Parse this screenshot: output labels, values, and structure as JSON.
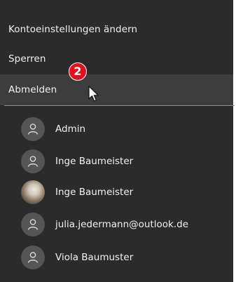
{
  "menu": {
    "items": [
      {
        "label": "Kontoeinstellungen ändern"
      },
      {
        "label": "Sperren"
      },
      {
        "label": "Abmelden"
      }
    ]
  },
  "users": [
    {
      "name": "Admin",
      "icon": "person-icon"
    },
    {
      "name": "Inge Baumeister",
      "icon": "person-icon"
    },
    {
      "name": "Inge Baumeister",
      "icon": "profile-photo"
    },
    {
      "name": "julia.jedermann@outlook.de",
      "icon": "person-icon"
    },
    {
      "name": "Viola Baumuster",
      "icon": "person-icon"
    }
  ],
  "annotation": {
    "badge": "2",
    "badge_color": "#e3101f"
  },
  "colors": {
    "menu_background": "#2b2b2b",
    "hover_background": "#3d3d3d",
    "text": "#f2f2f2",
    "avatar_background": "#555555"
  }
}
